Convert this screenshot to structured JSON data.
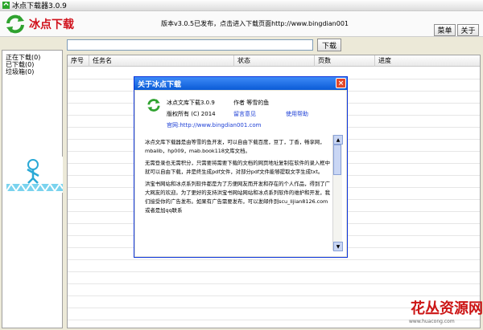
{
  "window": {
    "title": "冰点下载器3.0.9"
  },
  "banner": {
    "app_name": "冰点下载",
    "notice": "版本v3.0.5已发布，点击进入下载页面http://www.bingdian001",
    "menu_button": "菜单",
    "about_button": "关于"
  },
  "search": {
    "value": "",
    "download_button": "下载"
  },
  "categories": [
    "正在下载(0)",
    "已下载(0)",
    "垃圾箱(0)"
  ],
  "list": {
    "columns": [
      "序号",
      "任务名",
      "状态",
      "页数",
      "进度"
    ]
  },
  "dialog": {
    "title": "关于冰点下载",
    "close": "×",
    "app_version": "冰点文库下载3.0.9",
    "author": "作者 等雪的鱼",
    "copyright": "版权所有 (C) 2014",
    "feedback": "留言意见",
    "help": "使用帮助",
    "website_label": "官网:",
    "website": "http://www.bingdian001.com",
    "paragraphs": [
      "冰点文库下载器是由等雪的鱼开发，可以自由下载百度，豆丁，丁香，畅享网，mbalib，hp009，mab.book118文库文档。",
      "无需登录也无需积分，只需要将需要下载的文档的网页地址复制在软件的录入框中就可以自由下载，并是终生成pdf文件，对部分pdf文件能够提取文字生成txt。",
      "洪宝书网站和冰点系列软件都是为了方便网友而开发和存在的个人作品，得到了广大网友的欢迎。为了更好的支持洪宝书网站网站和冰点系列软件的维护和开发，我们接受你的广告发布。如果有广告需要发布，可以发邮件到scu_lijian8126.com或者是加qq联系"
    ]
  },
  "watermark": {
    "site": "花丛资源网",
    "url": "www.huacong.com"
  },
  "colors": {
    "accent": "#d0101a",
    "dialog_title": "#0a5bd6",
    "link": "#1d3fd6"
  }
}
